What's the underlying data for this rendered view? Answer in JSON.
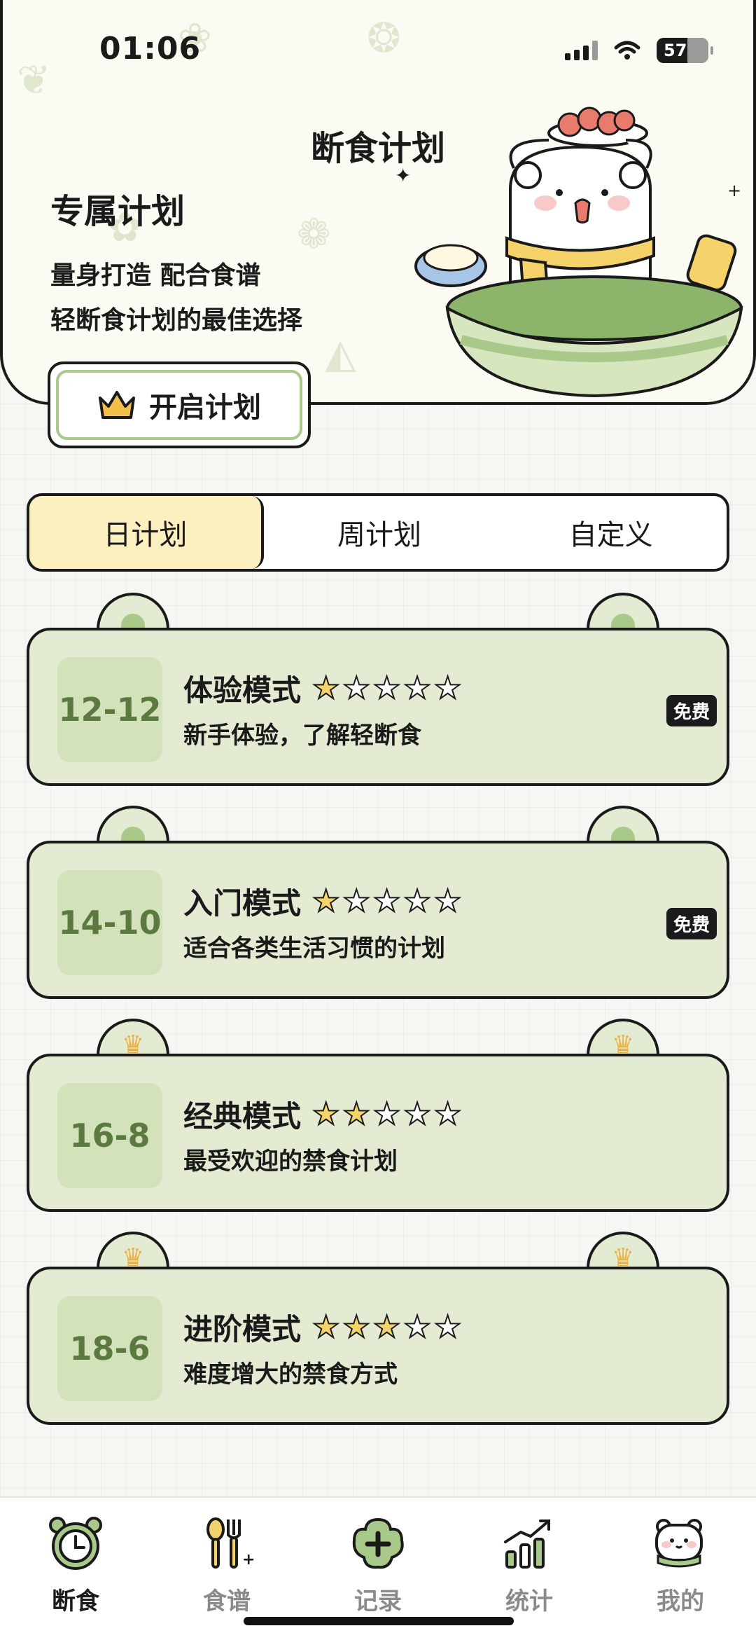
{
  "status_bar": {
    "time": "01:06",
    "battery": "57"
  },
  "header": {
    "title": "断食计划",
    "subtitle": "专属计划",
    "line1": "量身打造 配合食谱",
    "line2": "轻断食计划的最佳选择",
    "start_button": "开启计划"
  },
  "tabs": [
    {
      "label": "日计划",
      "active": true
    },
    {
      "label": "周计划",
      "active": false
    },
    {
      "label": "自定义",
      "active": false
    }
  ],
  "plans": [
    {
      "ratio": "12-12",
      "name": "体验模式",
      "stars": 1,
      "desc": "新手体验，了解轻断食",
      "badge": "免费",
      "ear": "dot"
    },
    {
      "ratio": "14-10",
      "name": "入门模式",
      "stars": 1,
      "desc": "适合各类生活习惯的计划",
      "badge": "免费",
      "ear": "dot"
    },
    {
      "ratio": "16-8",
      "name": "经典模式",
      "stars": 2,
      "desc": "最受欢迎的禁食计划",
      "badge": "",
      "ear": "crown"
    },
    {
      "ratio": "18-6",
      "name": "进阶模式",
      "stars": 3,
      "desc": "难度增大的禁食方式",
      "badge": "",
      "ear": "crown"
    }
  ],
  "nav": [
    {
      "label": "断食",
      "icon": "clock-icon",
      "active": true
    },
    {
      "label": "食谱",
      "icon": "spoon-fork-icon",
      "active": false
    },
    {
      "label": "记录",
      "icon": "add-record-icon",
      "active": false
    },
    {
      "label": "统计",
      "icon": "stats-icon",
      "active": false
    },
    {
      "label": "我的",
      "icon": "profile-bear-icon",
      "active": false
    }
  ],
  "colors": {
    "card": "#e3ebd2",
    "accent_green": "#a9c98a",
    "active_tab": "#fdf0c0",
    "star": "#f4d46a"
  }
}
